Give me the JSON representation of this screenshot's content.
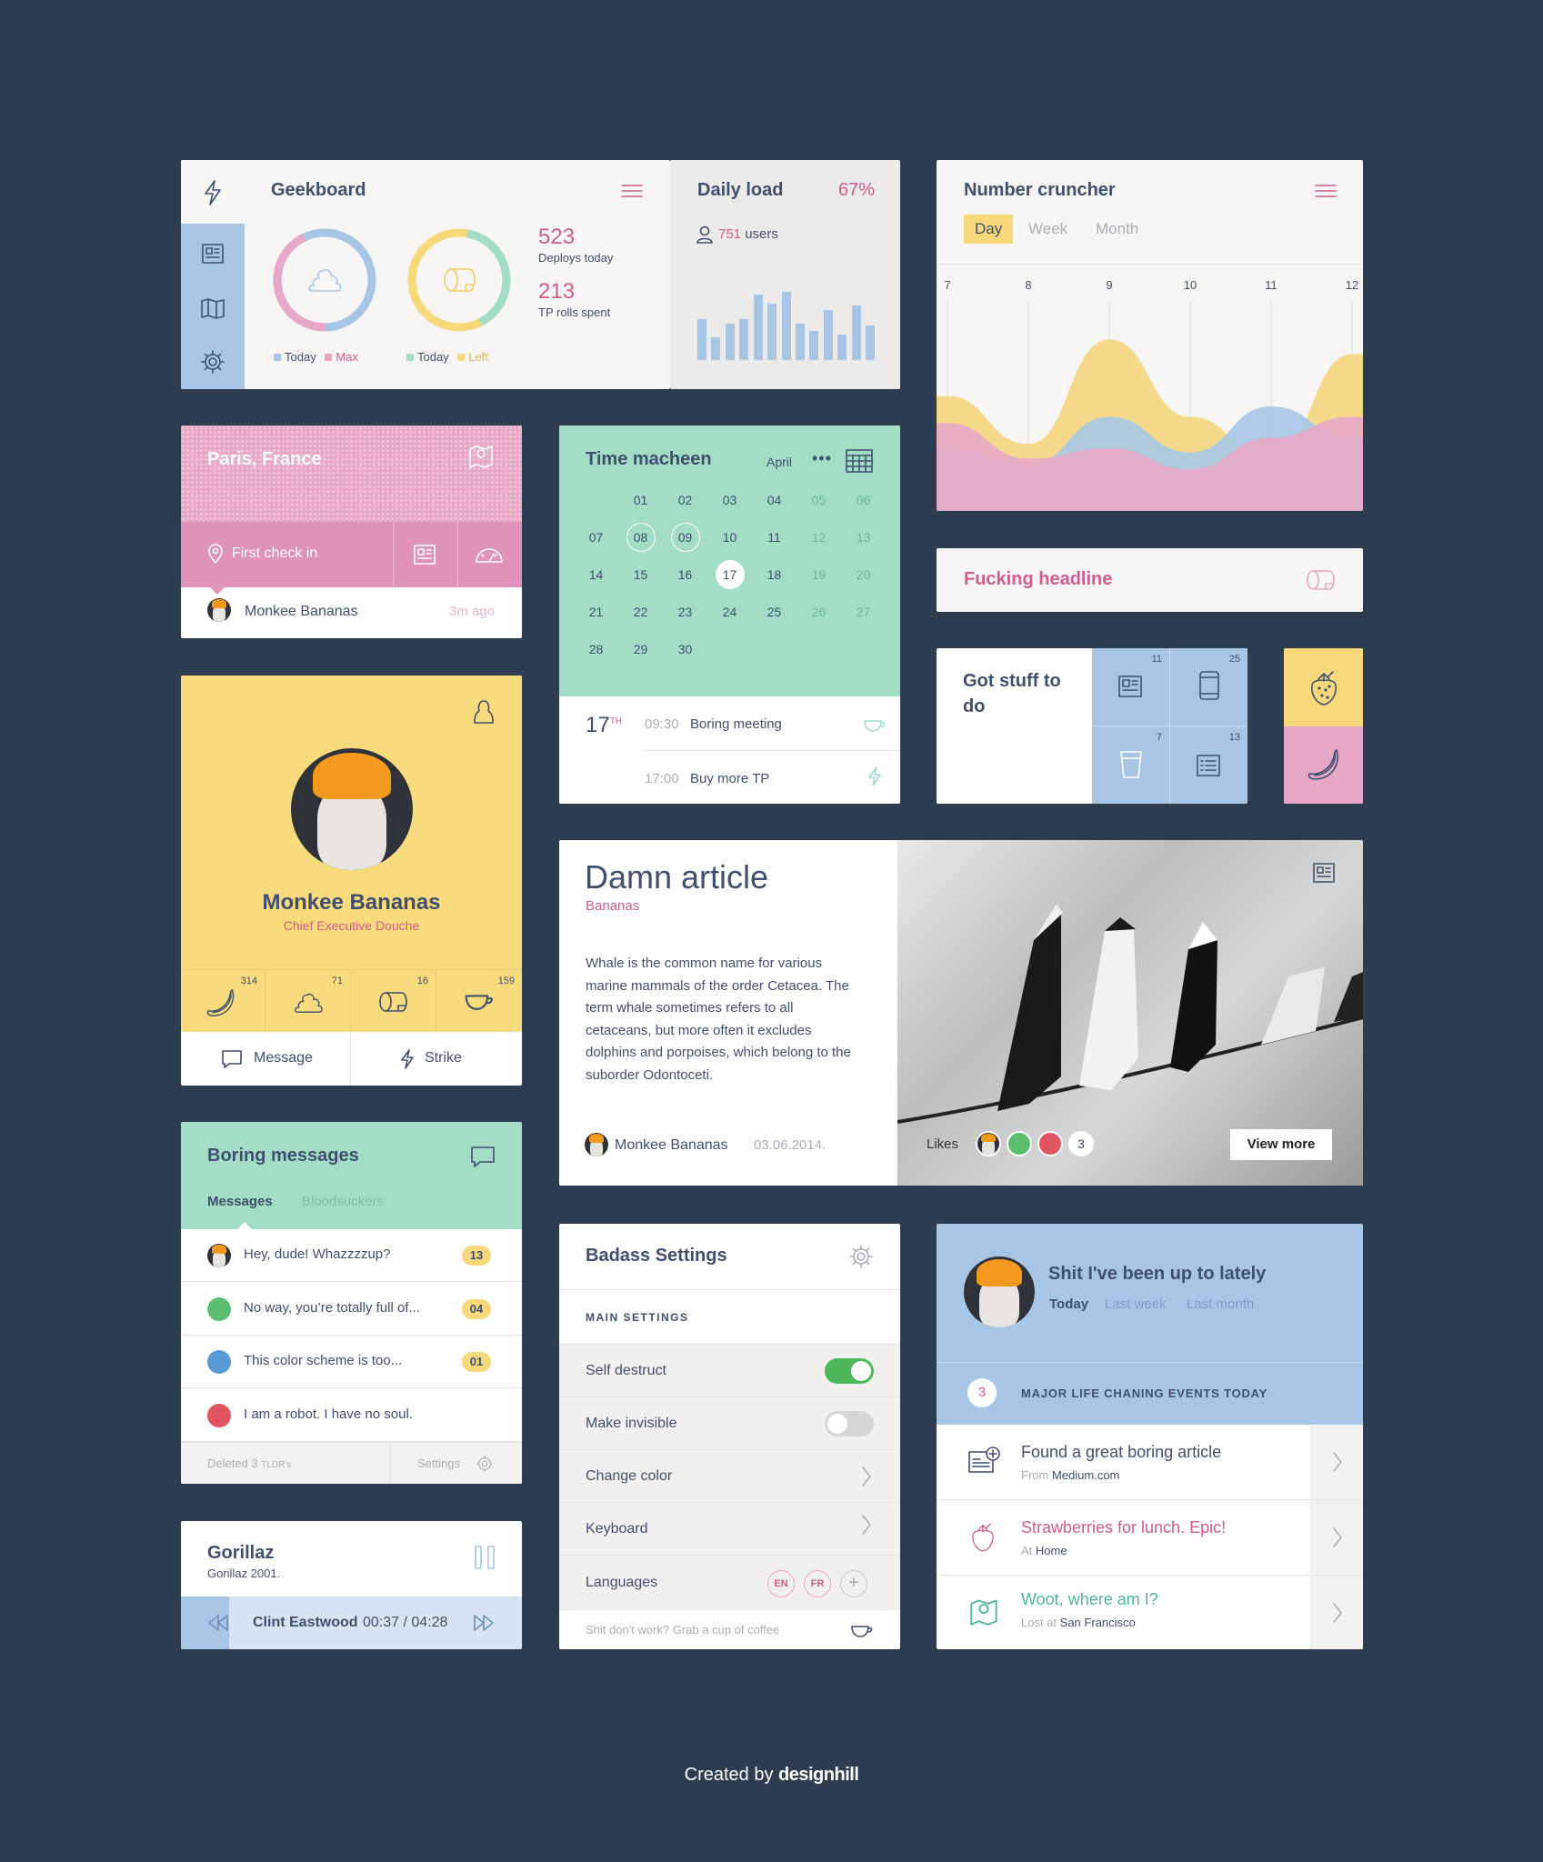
{
  "geekboard": {
    "title": "Geekboard",
    "deploys_value": "523",
    "deploys_label": "Deploys today",
    "tp_value": "213",
    "tp_label": "TP rolls spent",
    "legend1": [
      "Today",
      "Max"
    ],
    "legend2": [
      "Today",
      "Left"
    ]
  },
  "daily_load": {
    "title": "Daily load",
    "percent": "67%",
    "users_value": "751",
    "users_label": "users",
    "bars": [
      0.45,
      0.25,
      0.4,
      0.45,
      0.72,
      0.62,
      0.75,
      0.4,
      0.32,
      0.55,
      0.28,
      0.6,
      0.38
    ]
  },
  "number_cruncher": {
    "title": "Number cruncher",
    "tabs": [
      "Day",
      "Week",
      "Month"
    ],
    "ticks": [
      "7",
      "8",
      "9",
      "10",
      "11",
      "12"
    ]
  },
  "chart_data": {
    "type": "area",
    "x": [
      7,
      8,
      9,
      10,
      11,
      12
    ],
    "xlim": [
      7,
      12
    ],
    "grid": true,
    "series": [
      {
        "color": "#f4d680",
        "values": [
          0.55,
          0.32,
          0.82,
          0.45,
          0.25,
          0.75
        ]
      },
      {
        "color": "#a7c6e6",
        "values": [
          0.3,
          0.22,
          0.45,
          0.28,
          0.5,
          0.35
        ]
      },
      {
        "color": "#e6a8c6",
        "values": [
          0.42,
          0.25,
          0.3,
          0.2,
          0.35,
          0.45
        ]
      }
    ]
  },
  "location": {
    "city": "Paris, France",
    "checkin": "First check in",
    "user": "Monkee Bananas",
    "time": "3m ago"
  },
  "calendar": {
    "title": "Time macheen",
    "month": "April",
    "days": [
      [
        "",
        "01",
        "02",
        "03",
        "04",
        "05",
        "06"
      ],
      [
        "07",
        "08",
        "09",
        "10",
        "11",
        "12",
        "13"
      ],
      [
        "14",
        "15",
        "16",
        "17",
        "18",
        "19",
        "20"
      ],
      [
        "21",
        "22",
        "23",
        "24",
        "25",
        "26",
        "27"
      ],
      [
        "28",
        "29",
        "30",
        "",
        "",
        "",
        ""
      ]
    ],
    "today_num": "17",
    "today_sup": "TH",
    "events": [
      {
        "time": "09:30",
        "label": "Boring meeting"
      },
      {
        "time": "17:00",
        "label": "Buy more TP"
      }
    ]
  },
  "headline": {
    "text": "Fucking headline"
  },
  "todo": {
    "title": "Got stuff to do",
    "counts": [
      "11",
      "25",
      "7",
      "13"
    ]
  },
  "profile": {
    "name": "Monkee Bananas",
    "role": "Chief Executive Douche",
    "stats": [
      "314",
      "71",
      "16",
      "159"
    ],
    "message_label": "Message",
    "strike_label": "Strike"
  },
  "article": {
    "title": "Damn article",
    "subtitle": "Bananas",
    "body": "Whale  is the common name for various marine mammals of the order Cetacea. The term whale sometimes refers to all cetaceans, but more often it excludes dolphins and porpoises, which belong to the suborder Odontoceti.",
    "author": "Monkee Bananas",
    "date": "03.06.2014.",
    "likes_label": "Likes",
    "likes_count": "3",
    "view_more": "View more"
  },
  "messages": {
    "title": "Boring messages",
    "tabs": [
      "Messages",
      "Bloodsuckers"
    ],
    "items": [
      {
        "text": "Hey, dude! Whazzzzup?",
        "count": "13"
      },
      {
        "text": "No way, you’re totally full of...",
        "count": "04"
      },
      {
        "text": "This color scheme is too...",
        "count": "01"
      },
      {
        "text": "I am a robot. I have no soul.",
        "count": ""
      }
    ],
    "footer_left": "Deleted 3 ",
    "footer_left_small": "TLDR's",
    "footer_right": "Settings"
  },
  "settings": {
    "title": "Badass Settings",
    "section": "MAIN SETTINGS",
    "rows": [
      "Self destruct",
      "Make invisible",
      "Change color",
      "Keyboard",
      "Languages"
    ],
    "self_destruct_on": true,
    "make_invisible_on": false,
    "languages": [
      "EN",
      "FR"
    ],
    "footer": "Shit don't work? Grab a cup of coffee"
  },
  "activity": {
    "title": "Shit I've been up to lately",
    "tabs": [
      "Today",
      "Last week",
      "Last month"
    ],
    "event_count": "3",
    "event_label": "MAJOR LIFE CHANING EVENTS TODAY",
    "items": [
      {
        "title": "Found a great boring article",
        "pre": "From",
        "place": "Medium.com",
        "color": "#3f4f6d"
      },
      {
        "title": "Strawberries for lunch. Epic!",
        "pre": "At",
        "place": "Home",
        "color": "#d25d8a"
      },
      {
        "title": "Woot, where am I?",
        "pre": "Lost at",
        "place": "San Francisco",
        "color": "#49b895"
      }
    ]
  },
  "player": {
    "artist": "Gorillaz",
    "album": "Gorillaz 2001.",
    "track": "Clint Eastwood",
    "elapsed": "00:37",
    "total": "04:28",
    "progress": 0.14
  },
  "credit": {
    "text": "Created by",
    "brand": "designhill"
  }
}
